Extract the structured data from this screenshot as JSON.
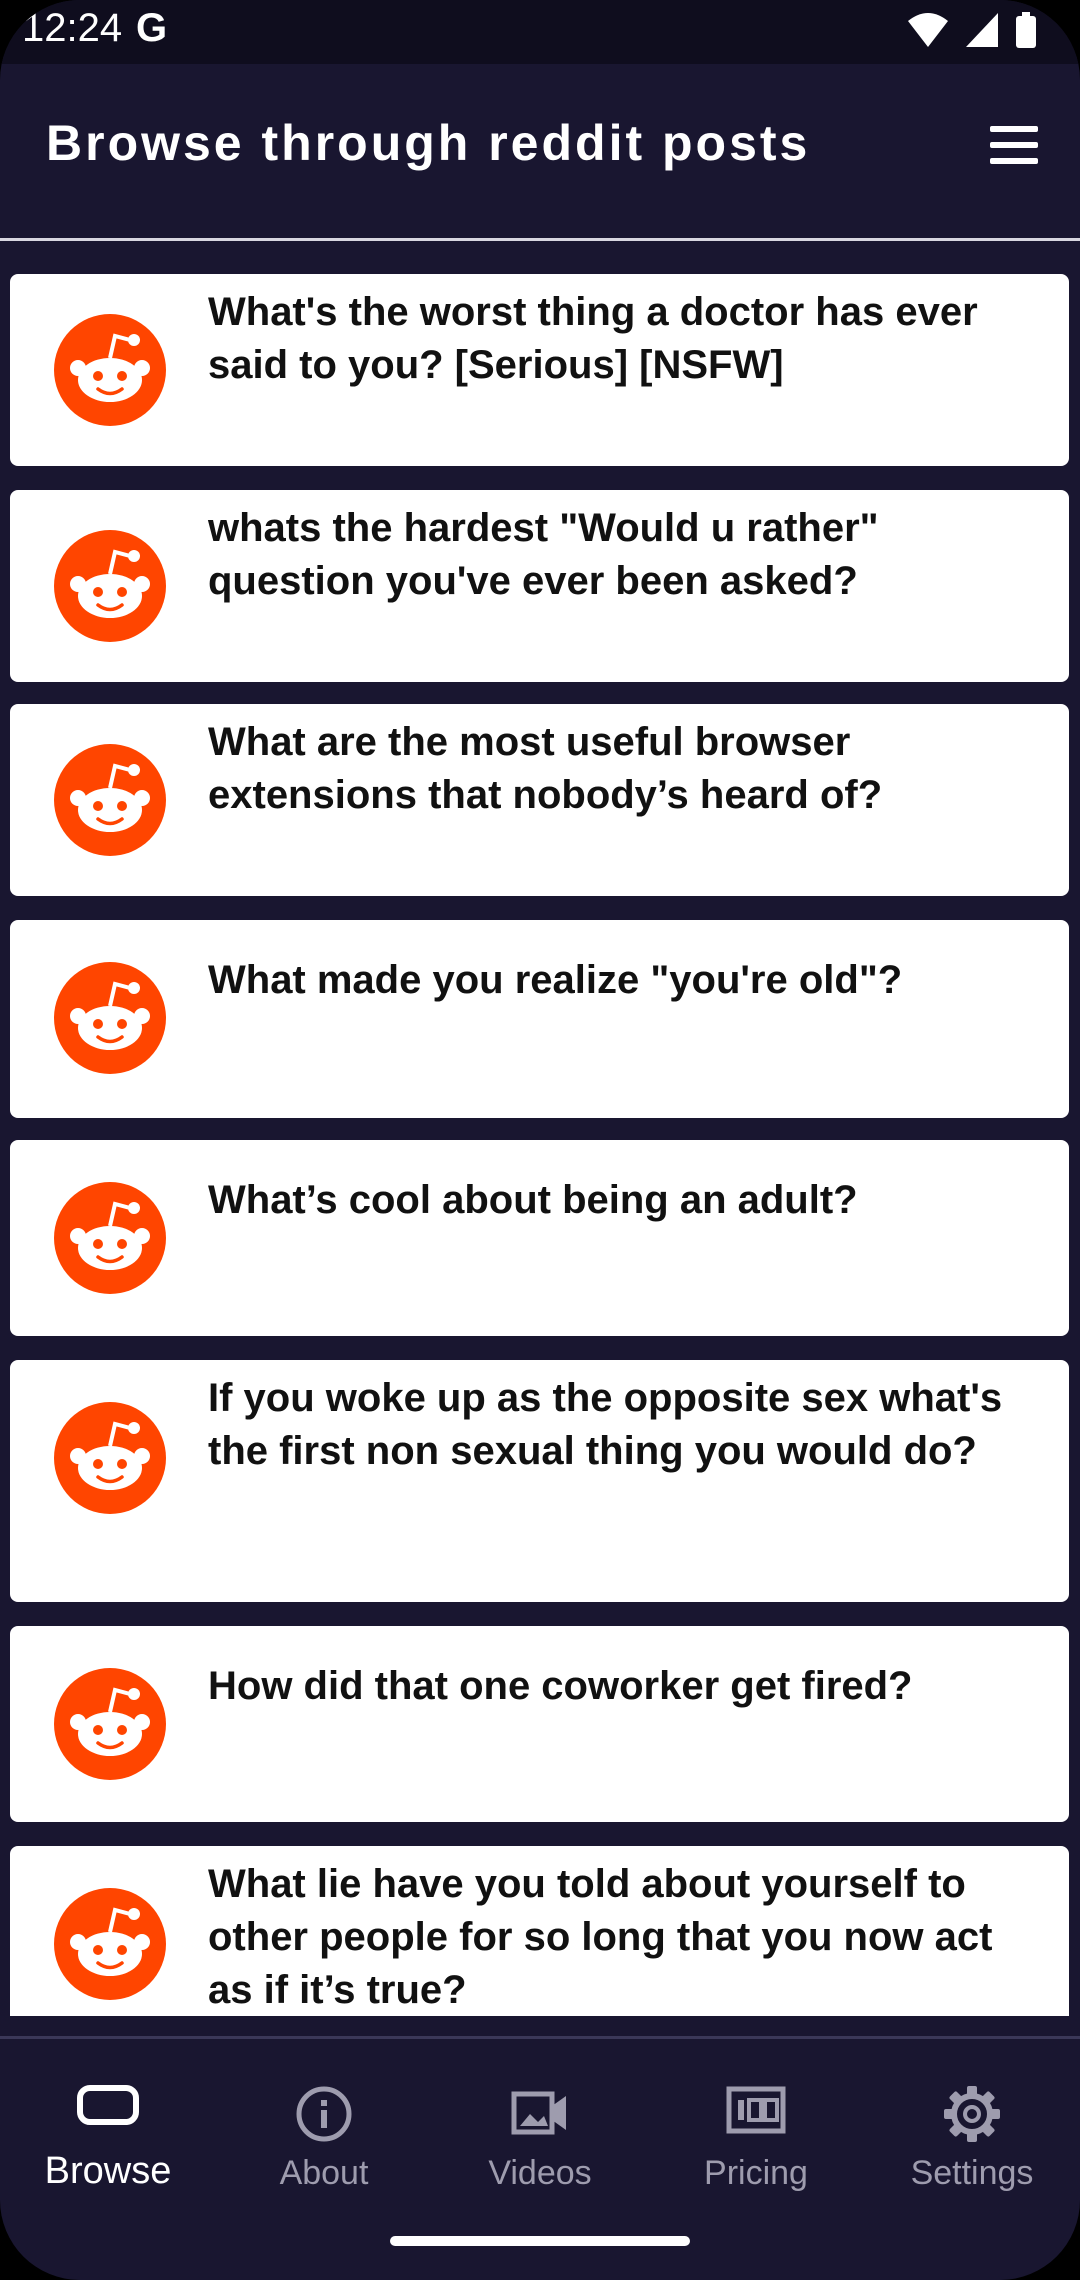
{
  "status": {
    "time": "12:24",
    "g_label": "G"
  },
  "header": {
    "title": "Browse through reddit posts"
  },
  "colors": {
    "background": "#191630",
    "reddit_orange": "#FF4500",
    "card": "#ffffff"
  },
  "posts": [
    {
      "title": "What's the worst thing a doctor has ever said to you? [Serious] [NSFW]"
    },
    {
      "title": "whats the hardest \"Would u rather\" question you've ever been asked?"
    },
    {
      "title": "What are the most useful browser extensions that nobody’s heard of?"
    },
    {
      "title": "What made you realize \"you're old\"?"
    },
    {
      "title": "What’s cool about being an adult?"
    },
    {
      "title": "If you woke up as the opposite sex what's the first non sexual thing you would do?"
    },
    {
      "title": "How did that one coworker get fired?"
    },
    {
      "title": "What lie have you told about yourself to other people for so long that you now act as if it’s true?"
    }
  ],
  "nav": [
    {
      "label": "Browse",
      "icon": "browse-icon",
      "active": true
    },
    {
      "label": "About",
      "icon": "info-icon",
      "active": false
    },
    {
      "label": "Videos",
      "icon": "video-icon",
      "active": false
    },
    {
      "label": "Pricing",
      "icon": "pricing-icon",
      "active": false
    },
    {
      "label": "Settings",
      "icon": "gear-icon",
      "active": false
    }
  ]
}
